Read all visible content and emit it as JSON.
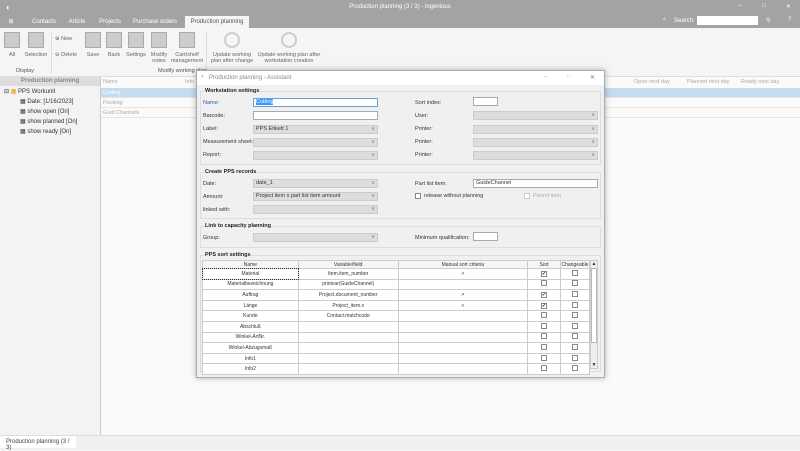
{
  "app": {
    "title": "Production planning (3 / 3) - ingenious",
    "search_label": "Search:",
    "help": "?"
  },
  "tabs": [
    "Contacts",
    "Article",
    "Projects",
    "Purchase orders",
    "Production planning"
  ],
  "ribbon": {
    "buttons": {
      "all": "All",
      "selection": "Selection",
      "new": "New",
      "delete": "Delete",
      "save": "Save",
      "back": "Back",
      "settings": "Settings",
      "modify_notes": "Modify notes",
      "cart": "Cart/shelf management",
      "update1": "Update working plan after change",
      "update2": "Update working plan after workstation creation"
    },
    "groups": {
      "display": "Display",
      "modify": "Modify working plan"
    }
  },
  "left_panel": {
    "title": "Production planning",
    "tree": [
      {
        "label": "PPS Workunit"
      },
      {
        "label": "Date: [1/16/2023]"
      },
      {
        "label": "show open [On]"
      },
      {
        "label": "show planned [On]"
      },
      {
        "label": "show ready [On]"
      }
    ]
  },
  "grid": {
    "headers": [
      "Name",
      "Info",
      "Open next day",
      "Planned next day",
      "Ready next day"
    ],
    "rows": [
      "Cutting",
      "Packing",
      "Guid Channels"
    ]
  },
  "status_tab": "Production planning (3 / 3)",
  "dialog": {
    "title": "Production planning - Assistant",
    "ws": {
      "legend": "Workstation settings",
      "name_label": "Name:",
      "name_value": "Cutting",
      "barcode_label": "Barcode:",
      "barcode_value": "",
      "label_label": "Label:",
      "label_value": "PPS Etikett 1",
      "measurement_label": "Measurement sheet:",
      "report_label": "Report:",
      "sort_index_label": "Sort index:",
      "user_label": "User:",
      "printer_label": "Printer:"
    },
    "pps": {
      "legend": "Create PPS records",
      "date_label": "Date:",
      "date_value": "date_1",
      "amount_label": "Amount:",
      "amount_value": "Project item x part list item amount",
      "linked_label": "linked with:",
      "part_label": "Part list item:",
      "part_value": "GuideChannel",
      "release_label": "release without planning",
      "parent_label": "Parent item"
    },
    "cap": {
      "legend": "Link to capacity planning",
      "group_label": "Group:",
      "minq_label": "Minimum qualification:"
    },
    "sort": {
      "legend": "PPS sort settings",
      "columns": [
        "Name",
        "Variable/field",
        "Manual sort criteria",
        "Sort",
        "Changeable"
      ],
      "rows": [
        {
          "name": "Material",
          "field": "Item.item_number",
          "criteria": ">",
          "sort": true,
          "changeable": false
        },
        {
          "name": "Materialbezeichnung",
          "field": "printvar(GuideChannel)",
          "criteria": "",
          "sort": false,
          "changeable": false
        },
        {
          "name": "Auftrag",
          "field": "Project.document_number",
          "criteria": ">",
          "sort": true,
          "changeable": false
        },
        {
          "name": "Länge",
          "field": "Project_item.x",
          "criteria": "<",
          "sort": true,
          "changeable": false
        },
        {
          "name": "Kunde",
          "field": "Contact.matchcode",
          "criteria": "",
          "sort": false,
          "changeable": false
        },
        {
          "name": "Abschluß",
          "field": "",
          "criteria": "",
          "sort": false,
          "changeable": false
        },
        {
          "name": "Winkel-ArtNr.",
          "field": "",
          "criteria": "",
          "sort": false,
          "changeable": false
        },
        {
          "name": "Winkel-Abzugsmaß",
          "field": "",
          "criteria": "",
          "sort": false,
          "changeable": false
        },
        {
          "name": "Info1",
          "field": "",
          "criteria": "",
          "sort": false,
          "changeable": false
        },
        {
          "name": "Info2",
          "field": "",
          "criteria": "",
          "sort": false,
          "changeable": false
        }
      ]
    }
  }
}
